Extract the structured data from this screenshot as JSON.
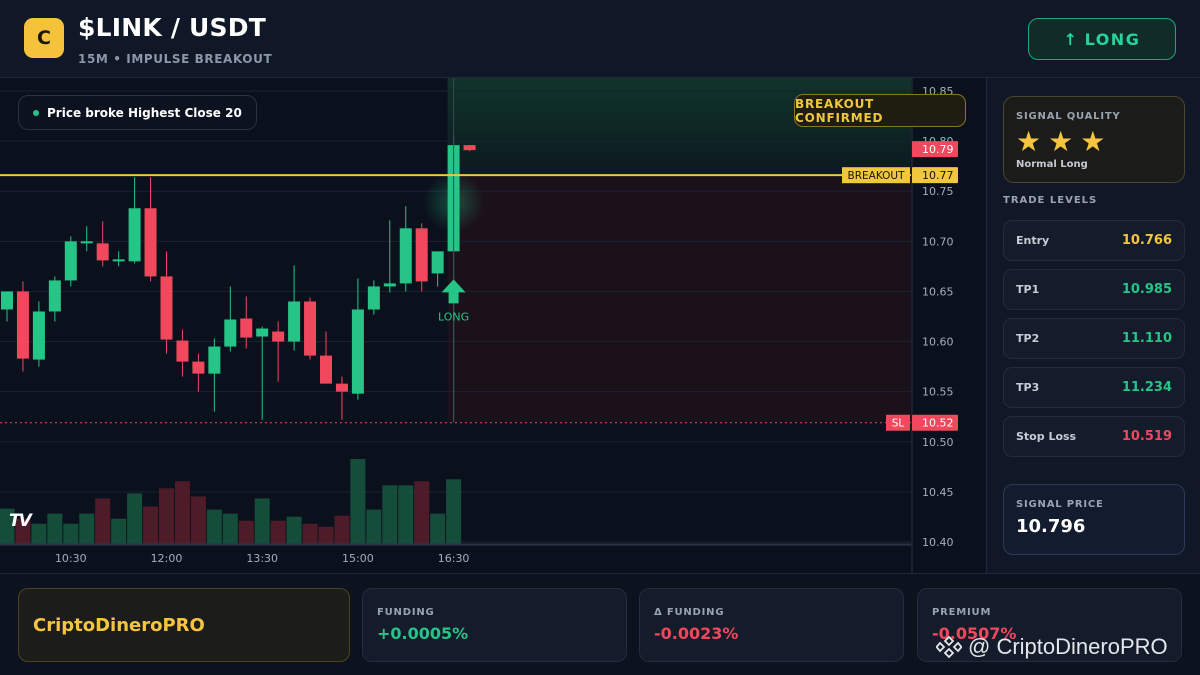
{
  "header": {
    "logo_letter": "C",
    "pair": "$LINK / USDT",
    "subtitle": "15M • IMPULSE BREAKOUT",
    "direction_arrow": "↑",
    "direction_label": "LONG"
  },
  "chart": {
    "badge_text": "Price broke Highest Close 20",
    "confirm_text": "BREAKOUT CONFIRMED",
    "tv_logo": "TV",
    "signal_marker_label": "LONG",
    "breakout_tag": "BREAKOUT",
    "sl_tag": "SL",
    "colors": {
      "up": "#26c486",
      "down": "#f0485d",
      "breakout": "#f1c73c",
      "grid": "#1a2230"
    }
  },
  "chart_data": {
    "type": "candlestick",
    "y_ticks": [
      "10.85",
      "10.80",
      "10.75",
      "10.70",
      "10.65",
      "10.60",
      "10.55",
      "10.50",
      "10.45",
      "10.40"
    ],
    "ylim": [
      10.4,
      10.85
    ],
    "x_ticks": [
      "10:30",
      "12:00",
      "13:30",
      "15:00",
      "16:30"
    ],
    "price_labels": {
      "last": "10.79",
      "breakout": "10.77",
      "stop": "10.52"
    },
    "breakout_level": 10.766,
    "stop_level": 10.519,
    "candles": [
      {
        "o": 10.632,
        "h": 10.65,
        "l": 10.62,
        "c": 10.65
      },
      {
        "o": 10.65,
        "h": 10.66,
        "l": 10.57,
        "c": 10.583
      },
      {
        "o": 10.582,
        "h": 10.64,
        "l": 10.575,
        "c": 10.63
      },
      {
        "o": 10.63,
        "h": 10.665,
        "l": 10.62,
        "c": 10.661
      },
      {
        "o": 10.661,
        "h": 10.705,
        "l": 10.655,
        "c": 10.7
      },
      {
        "o": 10.698,
        "h": 10.715,
        "l": 10.69,
        "c": 10.7
      },
      {
        "o": 10.698,
        "h": 10.72,
        "l": 10.675,
        "c": 10.681
      },
      {
        "o": 10.681,
        "h": 10.69,
        "l": 10.675,
        "c": 10.682
      },
      {
        "o": 10.68,
        "h": 10.764,
        "l": 10.678,
        "c": 10.733
      },
      {
        "o": 10.733,
        "h": 10.764,
        "l": 10.66,
        "c": 10.665
      },
      {
        "o": 10.665,
        "h": 10.69,
        "l": 10.588,
        "c": 10.602
      },
      {
        "o": 10.601,
        "h": 10.612,
        "l": 10.565,
        "c": 10.58
      },
      {
        "o": 10.58,
        "h": 10.588,
        "l": 10.55,
        "c": 10.568
      },
      {
        "o": 10.568,
        "h": 10.603,
        "l": 10.53,
        "c": 10.595
      },
      {
        "o": 10.595,
        "h": 10.655,
        "l": 10.59,
        "c": 10.622
      },
      {
        "o": 10.623,
        "h": 10.645,
        "l": 10.593,
        "c": 10.604
      },
      {
        "o": 10.605,
        "h": 10.615,
        "l": 10.522,
        "c": 10.613
      },
      {
        "o": 10.61,
        "h": 10.62,
        "l": 10.56,
        "c": 10.6
      },
      {
        "o": 10.6,
        "h": 10.676,
        "l": 10.591,
        "c": 10.64
      },
      {
        "o": 10.64,
        "h": 10.644,
        "l": 10.582,
        "c": 10.586
      },
      {
        "o": 10.586,
        "h": 10.61,
        "l": 10.558,
        "c": 10.558
      },
      {
        "o": 10.558,
        "h": 10.565,
        "l": 10.522,
        "c": 10.55
      },
      {
        "o": 10.548,
        "h": 10.663,
        "l": 10.542,
        "c": 10.632
      },
      {
        "o": 10.632,
        "h": 10.661,
        "l": 10.627,
        "c": 10.655
      },
      {
        "o": 10.655,
        "h": 10.721,
        "l": 10.649,
        "c": 10.658
      },
      {
        "o": 10.658,
        "h": 10.735,
        "l": 10.65,
        "c": 10.713
      },
      {
        "o": 10.713,
        "h": 10.718,
        "l": 10.65,
        "c": 10.66
      },
      {
        "o": 10.668,
        "h": 10.69,
        "l": 10.655,
        "c": 10.69
      },
      {
        "o": 10.69,
        "h": 10.806,
        "l": 10.52,
        "c": 10.796
      },
      {
        "o": 10.796,
        "h": 10.796,
        "l": 10.79,
        "c": 10.791
      }
    ],
    "volumes": [
      35,
      25,
      20,
      30,
      20,
      30,
      45,
      25,
      50,
      37,
      55,
      62,
      47,
      34,
      30,
      23,
      45,
      23,
      27,
      20,
      17,
      28,
      84,
      34,
      58,
      58,
      62,
      30,
      64,
      0
    ]
  },
  "right_panel": {
    "quality_label": "SIGNAL QUALITY",
    "stars_count": 3,
    "star_glyph": "★",
    "quality_text": "Normal Long",
    "levels_title": "TRADE LEVELS",
    "levels": [
      {
        "name": "Entry",
        "value": "10.766",
        "color": "#f5c542"
      },
      {
        "name": "TP1",
        "value": "10.985",
        "color": "#26c486"
      },
      {
        "name": "TP2",
        "value": "11.110",
        "color": "#26c486"
      },
      {
        "name": "TP3",
        "value": "11.234",
        "color": "#26c486"
      },
      {
        "name": "Stop Loss",
        "value": "10.519",
        "color": "#f0485d"
      }
    ],
    "signal_price_label": "SIGNAL PRICE",
    "signal_price": "10.796"
  },
  "footer": {
    "brand": "CriptoDineroPRO",
    "stats": [
      {
        "label": "FUNDING",
        "value": "+0.0005%",
        "color": "#26c486"
      },
      {
        "label": "Δ FUNDING",
        "value": "-0.0023%",
        "color": "#f0485d"
      },
      {
        "label": "PREMIUM",
        "value": "-0.0507%",
        "color": "#f0485d"
      }
    ],
    "watermark": "@ CriptoDineroPRO"
  }
}
